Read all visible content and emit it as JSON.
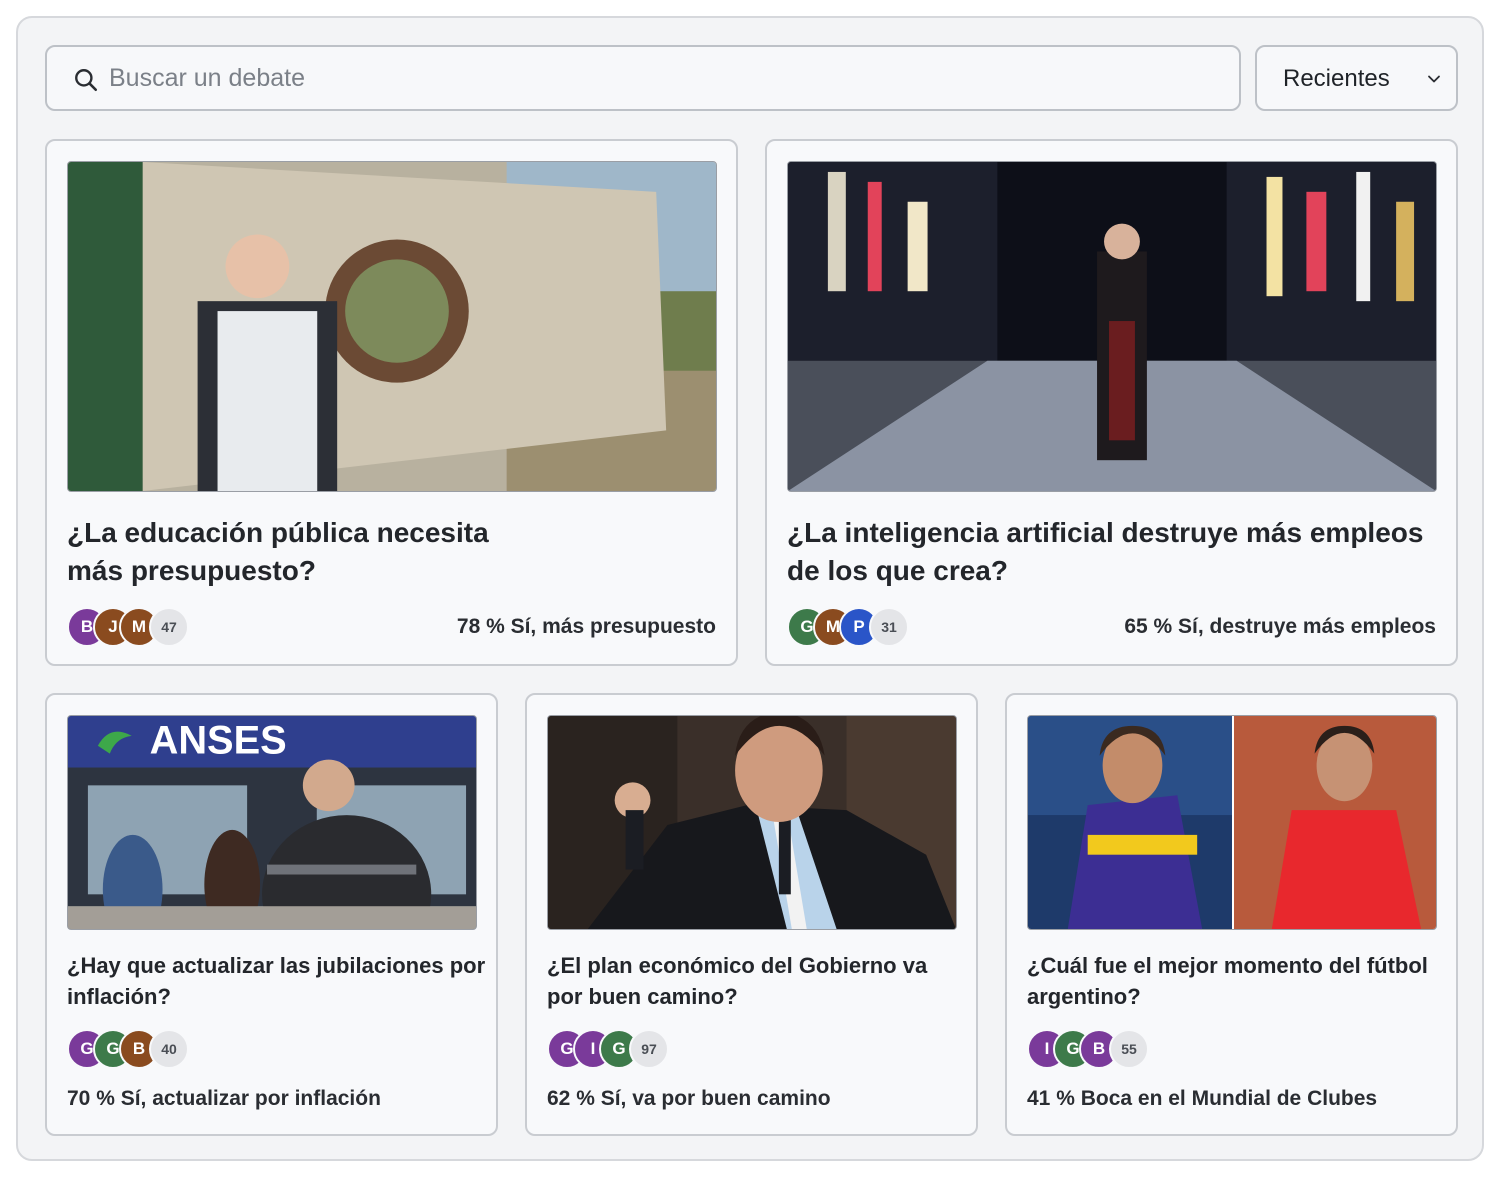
{
  "search": {
    "placeholder": "Buscar un debate"
  },
  "sort": {
    "selected": "Recientes"
  },
  "colors": {
    "purple": "#7a3a9a",
    "brown": "#8a4b1f",
    "green": "#3d7a4a",
    "blue": "#2a55c8"
  },
  "cards": [
    {
      "title": "¿La educación pública necesita más presupuesto?",
      "avatars": [
        {
          "letter": "B",
          "color": "purple"
        },
        {
          "letter": "J",
          "color": "brown"
        },
        {
          "letter": "M",
          "color": "brown"
        }
      ],
      "count": "47",
      "stat": "78 % Sí, más presupuesto"
    },
    {
      "title": "¿La inteligencia artificial destruye más empleos de los que crea?",
      "avatars": [
        {
          "letter": "G",
          "color": "green"
        },
        {
          "letter": "M",
          "color": "brown"
        },
        {
          "letter": "P",
          "color": "blue"
        }
      ],
      "count": "31",
      "stat": "65 % Sí, destruye más empleos"
    },
    {
      "title": "¿Hay que actualizar las jubilaciones por inflación?",
      "thumb_text": "ANSES",
      "avatars": [
        {
          "letter": "G",
          "color": "purple"
        },
        {
          "letter": "G",
          "color": "green"
        },
        {
          "letter": "B",
          "color": "brown"
        }
      ],
      "count": "40",
      "stat": "70 % Sí, actualizar por inflación"
    },
    {
      "title": "¿El plan económico del Gobierno va por buen camino?",
      "avatars": [
        {
          "letter": "G",
          "color": "purple"
        },
        {
          "letter": "I",
          "color": "purple"
        },
        {
          "letter": "G",
          "color": "green"
        }
      ],
      "count": "97",
      "stat": "62 % Sí, va por buen camino"
    },
    {
      "title": "¿Cuál fue el mejor momento del fútbol argentino?",
      "avatars": [
        {
          "letter": "I",
          "color": "purple"
        },
        {
          "letter": "G",
          "color": "green"
        },
        {
          "letter": "B",
          "color": "purple"
        }
      ],
      "count": "55",
      "stat": "41 % Boca en el Mundial de Clubes"
    }
  ]
}
